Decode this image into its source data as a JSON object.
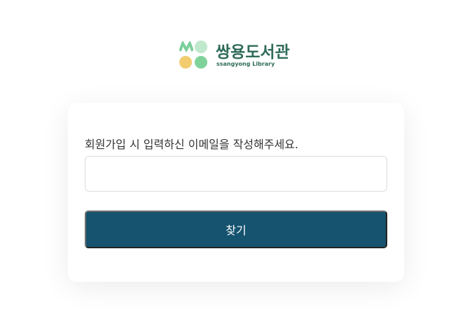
{
  "logo": {
    "name_ko": "쌍용도서관",
    "name_en": "ssangyong Library",
    "colors": [
      "#7ccf9c",
      "#bfe8cc",
      "#f2cc6e",
      "#7fd39a"
    ]
  },
  "form": {
    "label": "회원가입 시 입력하신 이메일을 작성해주세요.",
    "email_value": "",
    "submit_label": "찾기"
  },
  "colors": {
    "primary": "#15536f",
    "brand": "#2e6b58"
  }
}
